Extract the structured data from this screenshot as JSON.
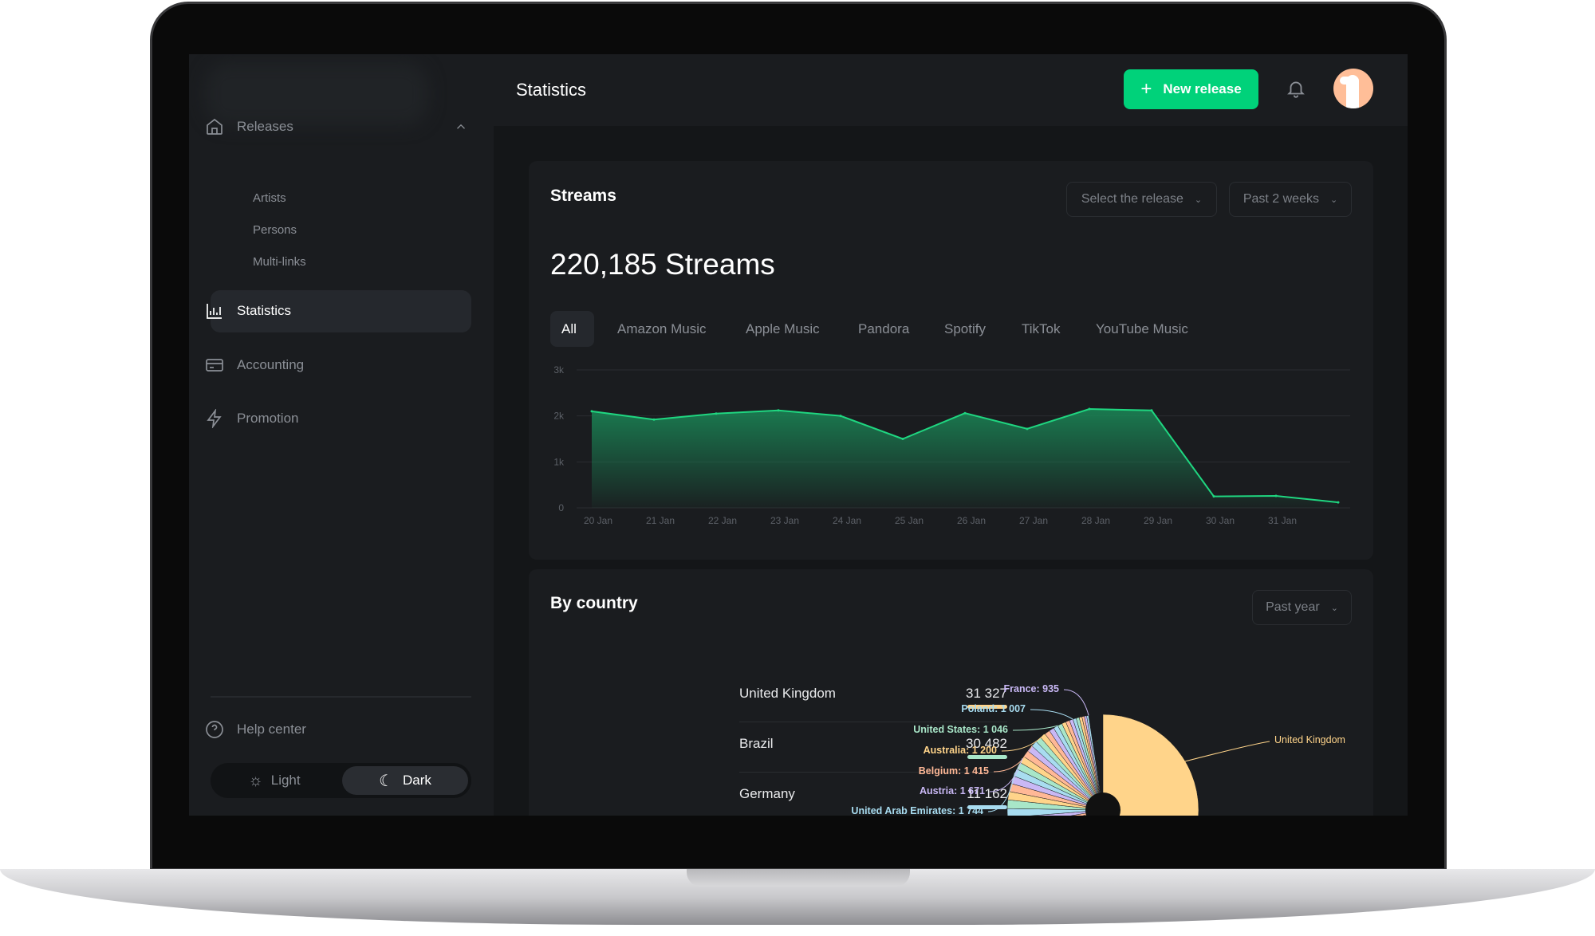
{
  "header": {
    "title": "Statistics",
    "new_release_label": "New release"
  },
  "sidebar": {
    "releases": "Releases",
    "sub_items": [
      "Artists",
      "Persons",
      "Multi-links"
    ],
    "items": [
      "Statistics",
      "Accounting",
      "Promotion"
    ],
    "help": "Help center",
    "theme": {
      "light": "Light",
      "dark": "Dark",
      "selected": "Dark"
    }
  },
  "streams": {
    "title": "Streams",
    "select_release": "Select the release",
    "period": "Past 2 weeks",
    "total": "220,185 Streams",
    "tabs": [
      "All",
      "Amazon Music",
      "Apple Music",
      "Pandora",
      "Spotify",
      "TikTok",
      "YouTube Music"
    ],
    "active_tab": "All"
  },
  "chart_data": {
    "type": "area",
    "categories": [
      "20 Jan",
      "21 Jan",
      "22 Jan",
      "23 Jan",
      "24 Jan",
      "25 Jan",
      "26 Jan",
      "27 Jan",
      "28 Jan",
      "29 Jan",
      "30 Jan",
      "31 Jan"
    ],
    "values": [
      2100,
      1920,
      2050,
      2120,
      2000,
      1500,
      2060,
      1720,
      2150,
      2120,
      250,
      260,
      120
    ],
    "yticks": [
      "0",
      "1k",
      "2k",
      "3k"
    ],
    "ylim": [
      0,
      3000
    ],
    "grid": true,
    "color": "#1fd680"
  },
  "by_country": {
    "title": "By country",
    "period": "Past year",
    "rows": [
      {
        "name": "United Kingdom",
        "value": "31 327",
        "color": "#ffd48a"
      },
      {
        "name": "Brazil",
        "value": "30 482",
        "color": "#a8e6c8"
      },
      {
        "name": "Germany",
        "value": "11 162",
        "color": "#a8dcf0"
      }
    ],
    "pie_labels": [
      {
        "text": "France: 935",
        "color": "#c9b8f5"
      },
      {
        "text": "Poland: 1 007",
        "color": "#a8dcf0"
      },
      {
        "text": "United States: 1 046",
        "color": "#a8e6c8"
      },
      {
        "text": "Australia: 1 200",
        "color": "#ffd48a"
      },
      {
        "text": "Belgium: 1 415",
        "color": "#ffb896"
      },
      {
        "text": "Austria: 1 671",
        "color": "#c9b8f5"
      },
      {
        "text": "United Arab Emirates: 1 744",
        "color": "#a8dcf0"
      },
      {
        "text": "United Kingdom",
        "color": "#ffd48a"
      }
    ]
  }
}
